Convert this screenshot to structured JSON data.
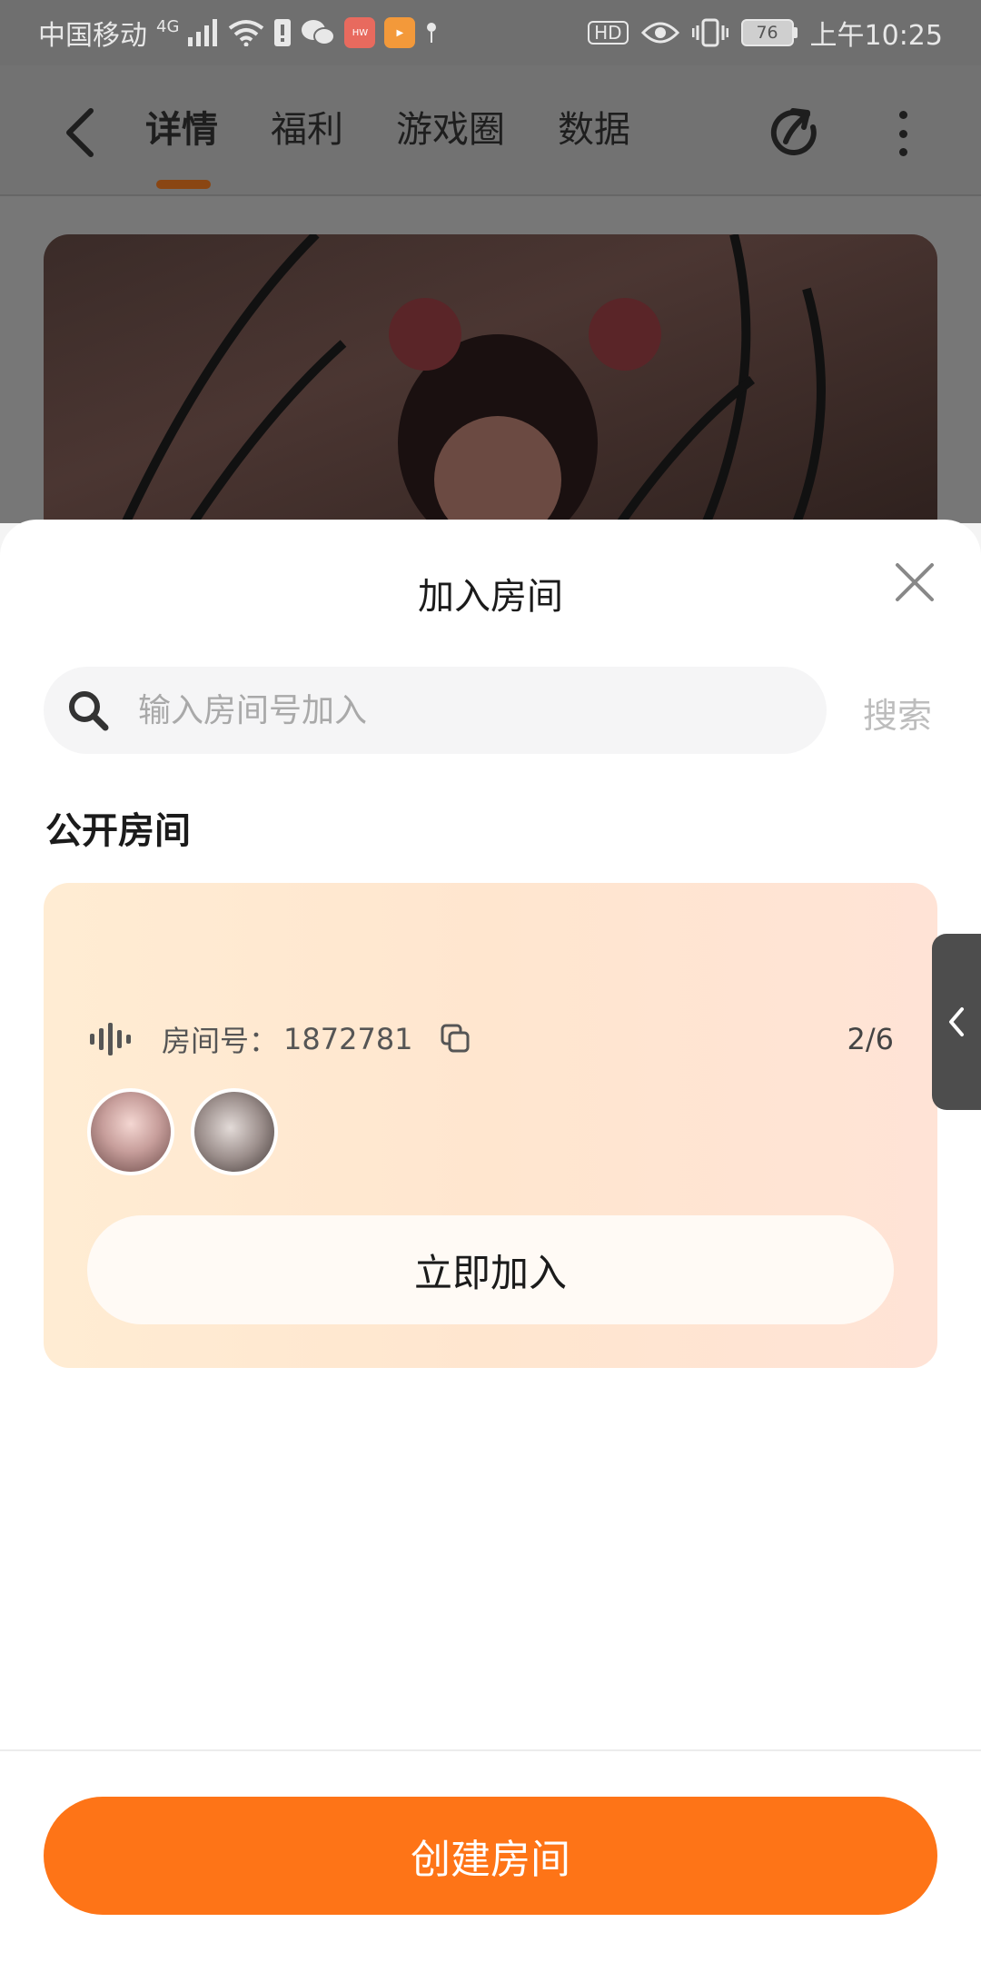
{
  "status_bar": {
    "carrier": "中国移动",
    "network": "4G",
    "hd_badge": "HD",
    "battery": "76",
    "time": "上午10:25"
  },
  "nav": {
    "tabs": [
      "详情",
      "福利",
      "游戏圈",
      "数据"
    ],
    "active_tab": 0
  },
  "sheet": {
    "title": "加入房间",
    "search_placeholder": "输入房间号加入",
    "search_button": "搜索",
    "section_title": "公开房间",
    "room": {
      "label": "房间号：",
      "number": "1872781",
      "count": "2/6",
      "join_button": "立即加入"
    },
    "create_button": "创建房间"
  },
  "colors": {
    "accent": "#fe7417",
    "card_start": "#ffecd3",
    "card_end": "#ffe3d6",
    "dim_overlay": "#727272"
  }
}
